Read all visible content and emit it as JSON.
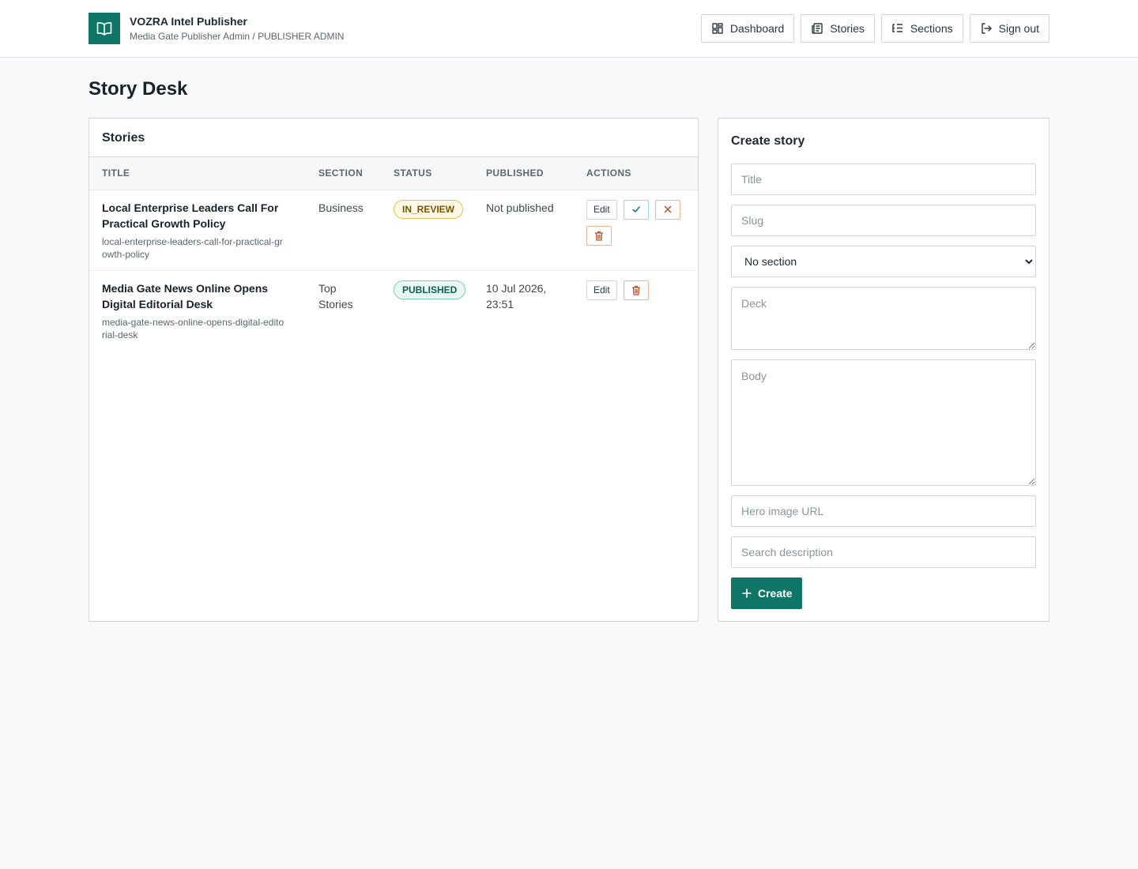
{
  "app": {
    "title": "VOZRA Intel Publisher",
    "subtitle": "Media Gate Publisher Admin / PUBLISHER ADMIN",
    "logo_icon": "book-open-icon",
    "accent_color": "#0f7566"
  },
  "nav": [
    {
      "label": "Dashboard",
      "icon": "dashboard-icon"
    },
    {
      "label": "Stories",
      "icon": "newspaper-icon"
    },
    {
      "label": "Sections",
      "icon": "list-tree-icon"
    },
    {
      "label": "Sign out",
      "icon": "sign-out-icon"
    }
  ],
  "page": {
    "title": "Story Desk"
  },
  "stories": {
    "heading": "Stories",
    "columns": [
      "Title",
      "Section",
      "Status",
      "Published",
      "Actions"
    ],
    "rows": [
      {
        "title": "Local Enterprise Leaders Call For Practical Growth Policy",
        "slug": "local-enterprise-leaders-call-for-practical-growth-policy",
        "section": "Business",
        "status": "IN_REVIEW",
        "published": "Not published",
        "edit_label": "Edit"
      },
      {
        "title": "Media Gate News Online Opens Digital Editorial Desk",
        "slug": "media-gate-news-online-opens-digital-editorial-desk",
        "section": "Top Stories",
        "status": "PUBLISHED",
        "published": "10 Jul 2026, 23:51",
        "edit_label": "Edit"
      }
    ]
  },
  "create": {
    "heading": "Create story",
    "title_placeholder": "Title",
    "slug_placeholder": "Slug",
    "section_selected": "No section",
    "deck_placeholder": "Deck",
    "body_placeholder": "Body",
    "hero_placeholder": "Hero image URL",
    "search_placeholder": "Search description",
    "submit_label": "Create"
  }
}
